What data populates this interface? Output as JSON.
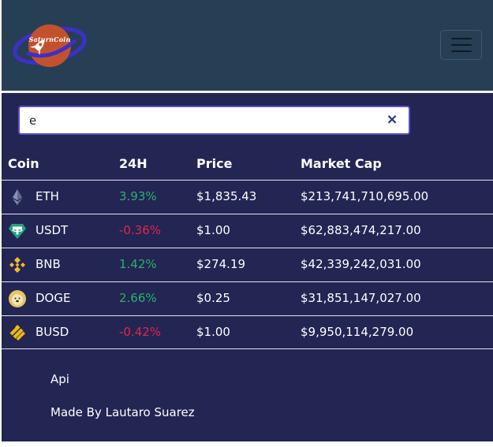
{
  "brand": {
    "name": "SaturnCoin"
  },
  "search": {
    "value": "e",
    "clear_symbol": "×"
  },
  "table": {
    "headers": {
      "coin": "Coin",
      "change": "24H",
      "price": "Price",
      "market_cap": "Market Cap"
    },
    "rows": [
      {
        "icon": "ethereum-icon",
        "symbol": "ETH",
        "change": "3.93%",
        "price": "$1,835.43",
        "market_cap": "$213,741,710,695.00"
      },
      {
        "icon": "tether-icon",
        "symbol": "USDT",
        "change": "-0.36%",
        "price": "$1.00",
        "market_cap": "$62,883,474,217.00"
      },
      {
        "icon": "bnb-icon",
        "symbol": "BNB",
        "change": "1.42%",
        "price": "$274.19",
        "market_cap": "$42,339,242,031.00"
      },
      {
        "icon": "dogecoin-icon",
        "symbol": "DOGE",
        "change": "2.66%",
        "price": "$0.25",
        "market_cap": "$31,851,147,027.00"
      },
      {
        "icon": "busd-icon",
        "symbol": "BUSD",
        "change": "-0.42%",
        "price": "$1.00",
        "market_cap": "$9,950,114,279.00"
      }
    ]
  },
  "footer": {
    "link": "Api",
    "credit": "Made By Lautaro Suarez"
  },
  "colors": {
    "navbar": "#263f55",
    "background": "#232553",
    "positive": "#27b36a",
    "negative": "#e0264a",
    "search_border": "#5a4fd0"
  }
}
